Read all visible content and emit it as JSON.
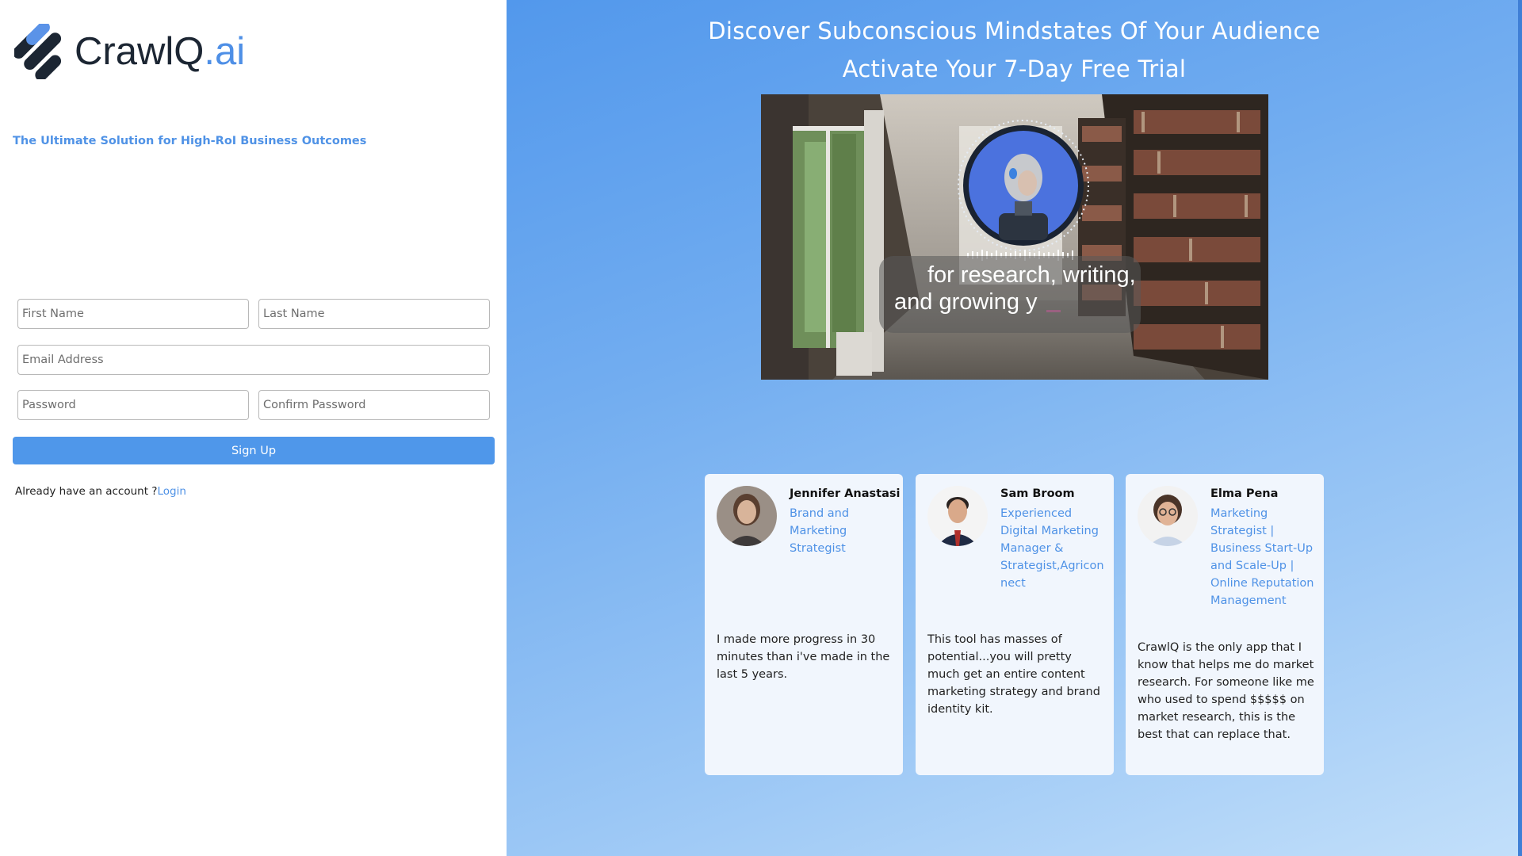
{
  "brand": {
    "name": "CrawlQ",
    "suffix": ".ai",
    "primary_color": "#4f97ea",
    "dark_color": "#1c2633"
  },
  "tagline": "The Ultimate Solution for High-RoI Business Outcomes",
  "form": {
    "first_name_placeholder": "First Name",
    "last_name_placeholder": "Last Name",
    "email_placeholder": "Email Address",
    "password_placeholder": "Password",
    "confirm_password_placeholder": "Confirm Password",
    "signup_label": "Sign Up",
    "login_prompt": "Already have an account ?",
    "login_link": "Login"
  },
  "hero": {
    "headline": "Discover Subconscious Mindstates Of Your Audience",
    "subheadline": "Activate Your 7-Day Free Trial"
  },
  "video": {
    "caption_line1": "for research, writing,",
    "caption_line2": "and growing y"
  },
  "testimonials": [
    {
      "name": "Jennifer Anastasi",
      "role": "Brand and Marketing Strategist",
      "quote": "I made more progress in 30 minutes than i've made in the last 5 years."
    },
    {
      "name": "Sam Broom",
      "role": "Experienced Digital Marketing Manager & Strategist,Agriconnect",
      "quote": "This tool has masses of potential...you will pretty much get an entire content marketing strategy and brand identity kit."
    },
    {
      "name": "Elma Pena",
      "role": "Marketing Strategist | Business Start-Up and Scale-Up | Online Reputation Management",
      "quote": "CrawlQ is the only app that I know that helps me do market research. For someone like me who used to spend $$$$$ on market research, this is the best that can replace that."
    }
  ]
}
